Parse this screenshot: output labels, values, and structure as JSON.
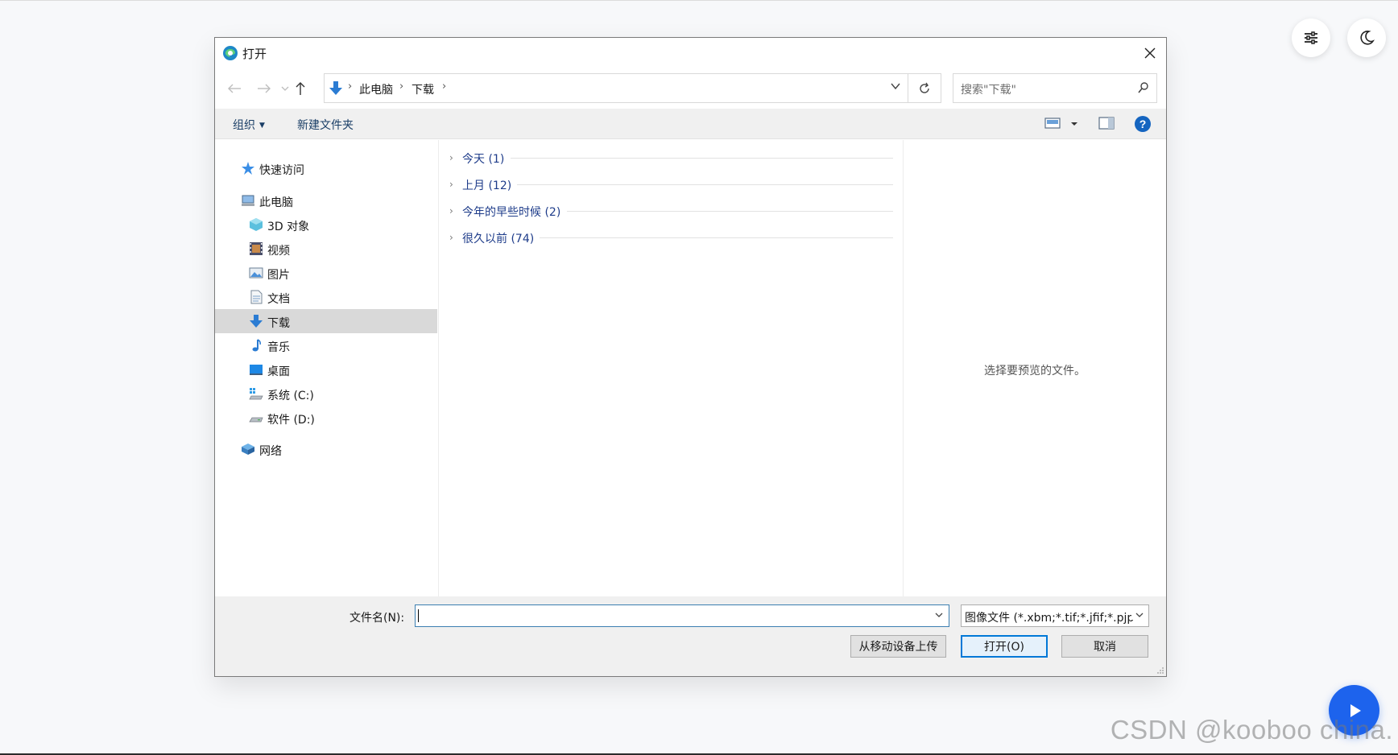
{
  "dialog": {
    "title": "打开",
    "nav": {
      "breadcrumbs": [
        "此电脑",
        "下载"
      ],
      "search_placeholder": "搜索\"下载\""
    },
    "toolbar": {
      "organize": "组织",
      "new_folder": "新建文件夹"
    },
    "sidebar": {
      "items": [
        {
          "label": "快速访问",
          "icon": "star-icon"
        },
        {
          "label": "此电脑",
          "icon": "computer-icon"
        },
        {
          "label": "3D 对象",
          "icon": "cube-icon"
        },
        {
          "label": "视频",
          "icon": "film-icon"
        },
        {
          "label": "图片",
          "icon": "picture-icon"
        },
        {
          "label": "文档",
          "icon": "document-icon"
        },
        {
          "label": "下载",
          "icon": "download-icon",
          "selected": true
        },
        {
          "label": "音乐",
          "icon": "music-note-icon"
        },
        {
          "label": "桌面",
          "icon": "desktop-icon"
        },
        {
          "label": "系统 (C:)",
          "icon": "drive-icon"
        },
        {
          "label": "软件 (D:)",
          "icon": "drive-icon"
        },
        {
          "label": "网络",
          "icon": "network-icon"
        }
      ]
    },
    "groups": [
      {
        "label": "今天 (1)"
      },
      {
        "label": "上月 (12)"
      },
      {
        "label": "今年的早些时候 (2)"
      },
      {
        "label": "很久以前 (74)"
      }
    ],
    "preview_message": "选择要预览的文件。",
    "footer": {
      "filename_label": "文件名(N):",
      "filename_value": "",
      "filter_value": "图像文件 (*.xbm;*.tif;*.jfif;*.pjp",
      "upload_button": "从移动设备上传",
      "open_button": "打开(O)",
      "cancel_button": "取消"
    }
  },
  "page": {
    "watermark": "CSDN @kooboo china."
  },
  "colors": {
    "accent": "#0078d7",
    "link": "#1e3c8a",
    "play_button": "#1d63ed"
  }
}
